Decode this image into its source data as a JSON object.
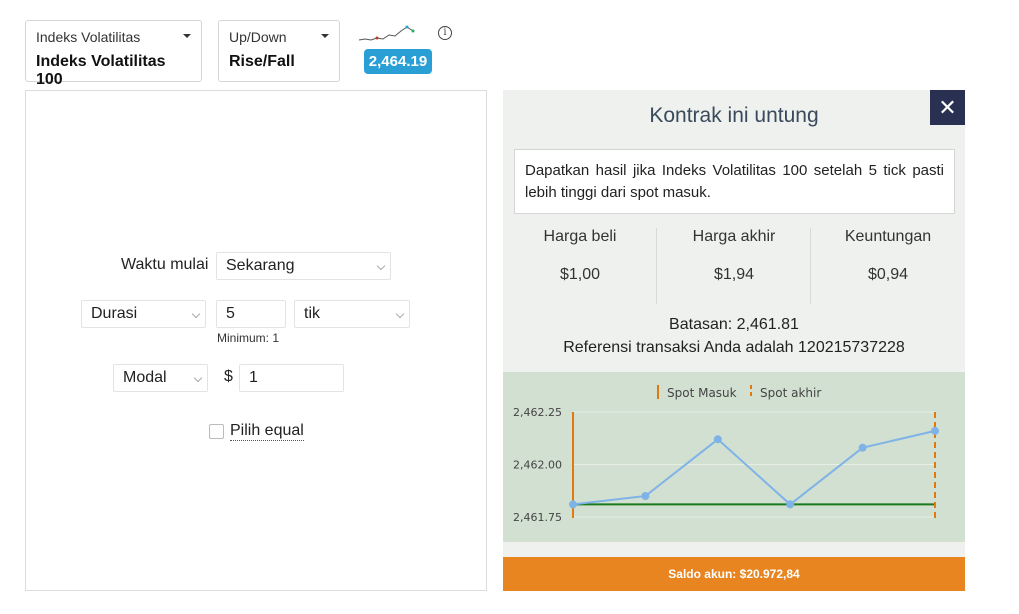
{
  "header": {
    "market_selector": {
      "label": "Indeks Volatilitas",
      "value": "Indeks Volatilitas 100"
    },
    "type_selector": {
      "label": "Up/Down",
      "value": "Rise/Fall"
    },
    "spot_price": "2,464.19",
    "info_icon": "info-icon"
  },
  "form": {
    "start_time_label": "Waktu mulai",
    "start_time_value": "Sekarang",
    "duration_label": "Durasi",
    "duration_value": "5",
    "duration_unit": "tik",
    "duration_minimum": "Minimum: 1",
    "stake_label": "Modal",
    "currency_symbol": "$",
    "stake_value": "1",
    "equal_label": "Pilih equal"
  },
  "result": {
    "title": "Kontrak ini untung",
    "close_icon": "close-icon",
    "description": "Dapatkan hasil jika Indeks Volatilitas 100 setelah 5 tick pasti lebih tinggi dari spot masuk.",
    "buy_price_label": "Harga beli",
    "buy_price_value": "$1,00",
    "final_price_label": "Harga akhir",
    "final_price_value": "$1,94",
    "profit_label": "Keuntungan",
    "profit_value": "$0,94",
    "barrier": "Batasan: 2,461.81",
    "reference": "Referensi transaksi Anda adalah 120215737228",
    "balance": "Saldo akun: $20.972,84"
  },
  "chart_data": {
    "type": "line",
    "x": [
      1,
      2,
      3,
      4,
      5,
      6
    ],
    "series": [
      {
        "values": [
          2461.81,
          2461.85,
          2462.12,
          2461.81,
          2462.08,
          2462.16
        ]
      }
    ],
    "barrier": 2461.81,
    "yticks": [
      "2,462.25",
      "2,462.00",
      "2,461.75"
    ],
    "ytick_values": [
      2462.25,
      2462.0,
      2461.75
    ],
    "ylim": [
      2461.75,
      2462.25
    ],
    "legend": [
      "Spot Masuk",
      "Spot akhir"
    ],
    "legend_placement": "top-center",
    "colors": {
      "line": "#7fb3e8",
      "barrier": "#1a7a1a",
      "markers": "#e07a10"
    }
  }
}
